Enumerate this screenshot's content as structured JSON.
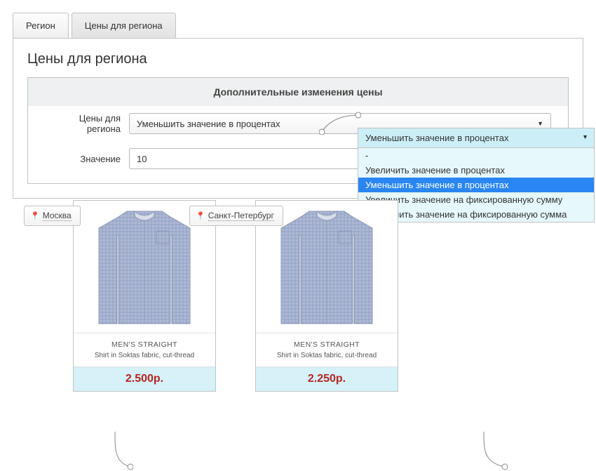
{
  "tabs": {
    "region": "Регион",
    "prices": "Цены для региона"
  },
  "panel": {
    "title": "Цены для региона"
  },
  "form": {
    "header": "Дополнительные изменения цены",
    "field1_label": "Цены для региона",
    "field1_value": "Уменьшить значение в процентах",
    "field2_label": "Значение",
    "field2_value": "10"
  },
  "dropdown": {
    "selected": "Уменьшить значение в процентах",
    "options": {
      "o0": "-",
      "o1": "Увеличить значение в процентах",
      "o2": "Уменьшить значение в процентах",
      "o3": "Увеличить значение на фиксированную сумму",
      "o4": "Уменьшить значение на фиксированную сумма"
    }
  },
  "regions": {
    "r1": "Москва",
    "r2": "Санкт-Петербург"
  },
  "product": {
    "title": "MEN'S STRAIGHT",
    "sub": "Shirt in Soktas fabric, cut-thread",
    "price1": "2.500р.",
    "price2": "2.250р."
  },
  "colors": {
    "shirt_main": "#aeb9d4",
    "shirt_grid": "#8b9ac2",
    "shirt_collar": "#d7ddea"
  }
}
